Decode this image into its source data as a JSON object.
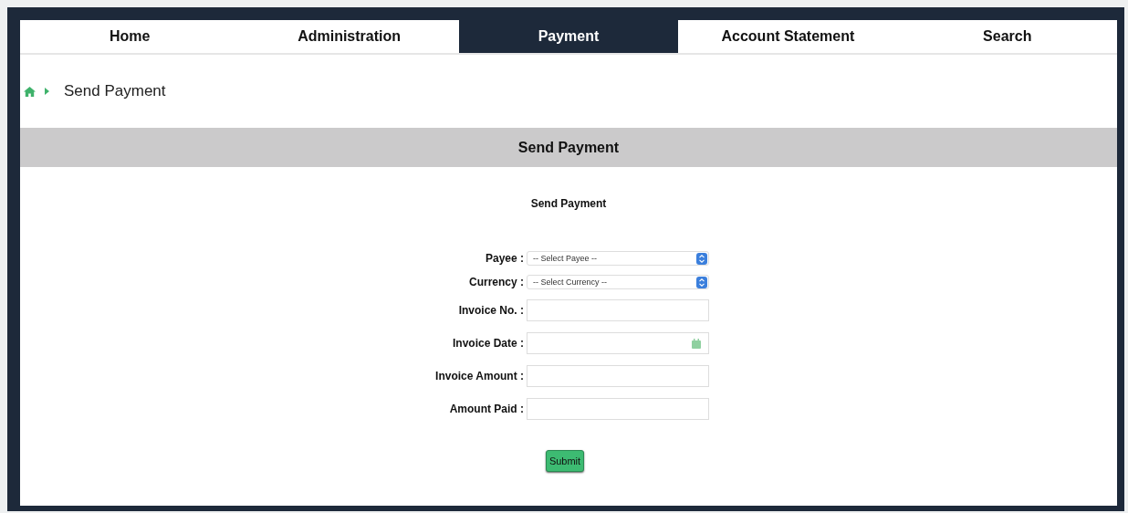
{
  "nav": {
    "tabs": [
      {
        "label": "Home",
        "selected": false
      },
      {
        "label": "Administration",
        "selected": false
      },
      {
        "label": "Payment",
        "selected": true
      },
      {
        "label": "Account Statement",
        "selected": false
      },
      {
        "label": "Search",
        "selected": false
      }
    ]
  },
  "breadcrumb": {
    "items": [
      "Send Payment"
    ]
  },
  "panel": {
    "title": "Send Payment",
    "subtitle": "Send Payment"
  },
  "form": {
    "fields": [
      {
        "kind": "select",
        "label": "Payee :",
        "value": "-- Select Payee --"
      },
      {
        "kind": "select",
        "label": "Currency :",
        "value": "-- Select Currency --"
      },
      {
        "kind": "text",
        "label": "Invoice No. :"
      },
      {
        "kind": "date",
        "label": "Invoice Date :"
      },
      {
        "kind": "text",
        "label": "Invoice Amount :"
      },
      {
        "kind": "text",
        "label": "Amount Paid :"
      }
    ],
    "submit": "Submit"
  }
}
